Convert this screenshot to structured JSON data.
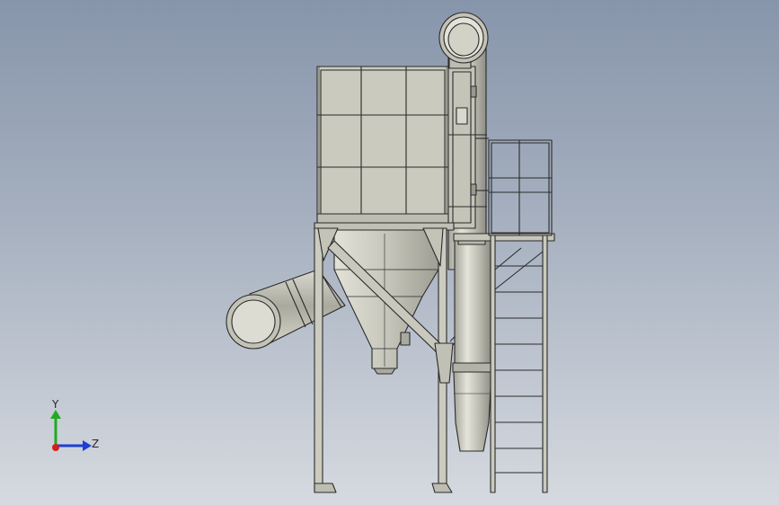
{
  "viewport": {
    "background_top": "#8795ab",
    "background_bottom": "#d6dae0"
  },
  "model": {
    "part_color": "#c9c9bd",
    "edge_color": "#2b2b2b"
  },
  "triad": {
    "y_label": "Y",
    "z_label": "Z",
    "y_color": "#22aa22",
    "z_color": "#1e3fd6",
    "x_color": "#d02020"
  }
}
